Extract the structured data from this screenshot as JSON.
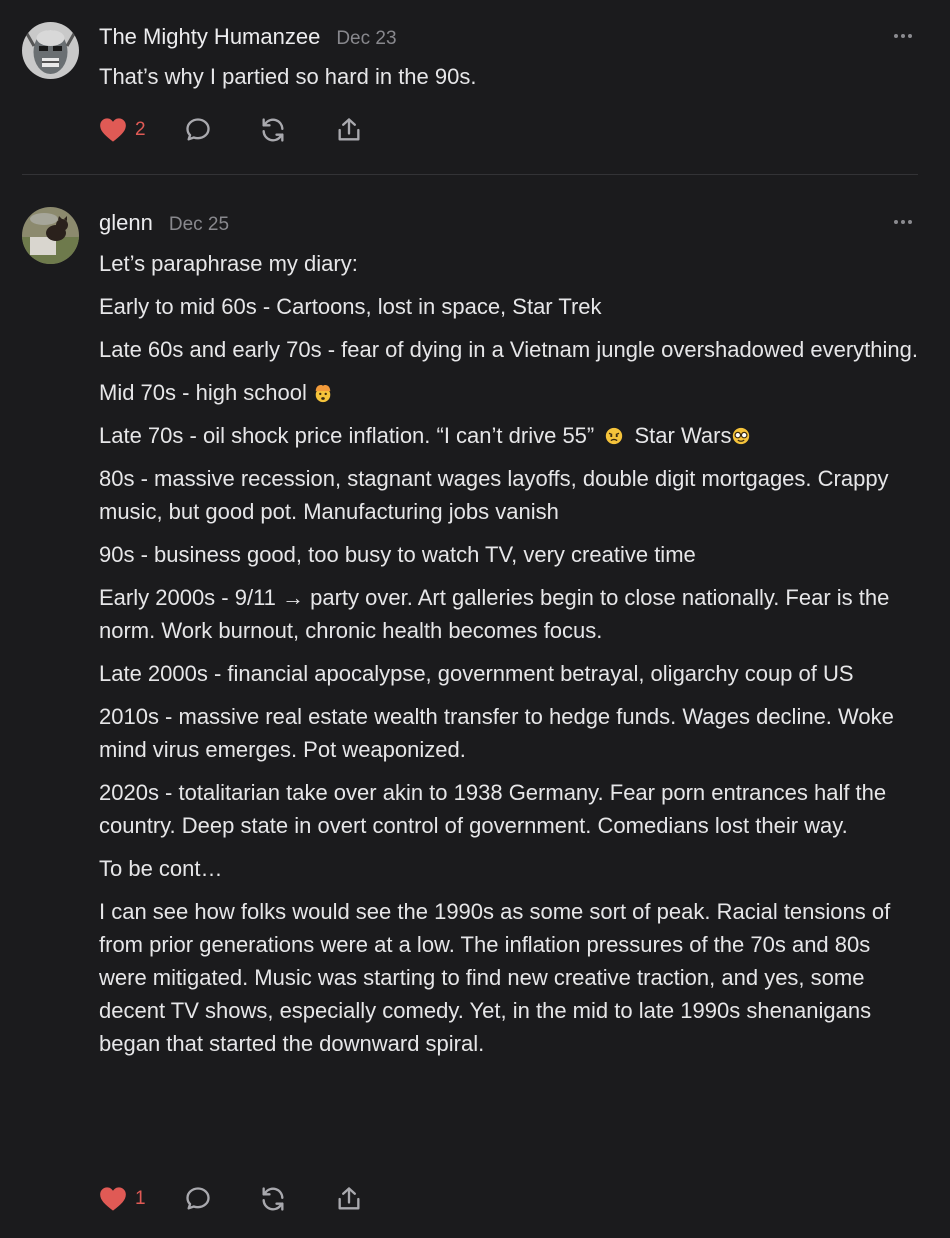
{
  "comments": [
    {
      "author": "The Mighty Humanzee",
      "date": "Dec 23",
      "paragraphs": [
        "That’s why I partied so hard in the 90s."
      ],
      "likes": "2",
      "liked": true
    },
    {
      "author": "glenn",
      "date": "Dec 25",
      "paragraphs": [
        "Let’s paraphrase my diary:",
        "Early to mid 60s - Cartoons, lost in space, Star Trek",
        "Late 60s and early 70s - fear of dying in a Vietnam jungle overshadowed everything.",
        "Mid 70s - high school",
        "Late 70s - oil shock price inflation. “I can’t drive 55”",
        "Star Wars",
        "80s - massive recession, stagnant wages layoffs, double digit mortgages. Crappy music, but good pot. Manufacturing jobs vanish",
        "90s - business good, too busy to watch TV, very creative time",
        "Early 2000s - 9/11 → party over. Art galleries begin to close nationally. Fear is the norm. Work burnout, chronic health becomes focus.",
        "Late 2000s - financial apocalypse, government betrayal, oligarchy coup of US",
        "2010s - massive real estate wealth transfer to hedge funds. Wages decline. Woke mind virus emerges. Pot weaponized.",
        "2020s - totalitarian take over akin to 1938 Germany. Fear porn entrances half the country. Deep state in overt control of government. Comedians lost their way.",
        "To be cont…",
        "I can see how folks would see the 1990s as some sort of peak. Racial tensions of from prior generations were at a low. The inflation pressures of the 70s and 80s were mitigated. Music was starting to find new creative traction, and yes, some decent TV shows, especially comedy. Yet, in the mid to late 1990s shenanigans began that started the downward spiral."
      ],
      "likes": "1",
      "liked": true
    }
  ],
  "colors": {
    "background": "#1b1b1d",
    "like": "#e05a55",
    "text": "#e6e6e8",
    "muted": "#88888d"
  },
  "icons": [
    "heart-icon",
    "comment-icon",
    "restack-icon",
    "share-icon",
    "more-icon",
    "exploding-head-emoji",
    "angry-emoji",
    "nerd-emoji"
  ]
}
